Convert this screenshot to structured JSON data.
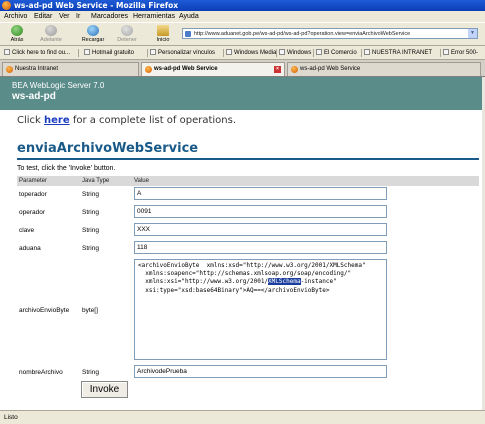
{
  "window": {
    "title": "ws-ad-pd Web Service - Mozilla Firefox"
  },
  "menu": [
    "Archivo",
    "Editar",
    "Ver",
    "Ir",
    "Marcadores",
    "Herramientas",
    "Ayuda"
  ],
  "nav": {
    "back": "Atrás",
    "forward": "Adelante",
    "reload": "Recargar",
    "stop": "Detener",
    "home": "Inicio",
    "url": "http://www.aduanet.gob.pe/ws-ad-pd/ws-ad-pd?operation.view=enviaArchivoWebService"
  },
  "bookmarks": [
    "Click here to find ou...",
    "Hotmail gratuito",
    "Personalizar vínculos",
    "Windows Media",
    "Windows",
    "El Comercio",
    "NUESTRA INTRANET",
    "Error 500-"
  ],
  "tabs": [
    {
      "label": "Nuestra Intranet",
      "active": false
    },
    {
      "label": "ws-ad-pd Web Service",
      "active": true
    },
    {
      "label": "ws-ad-pd Web Service",
      "active": false
    }
  ],
  "banner": {
    "line1": "BEA WebLogic Server 7.0",
    "line2": "ws-ad-pd"
  },
  "intro": {
    "before": "Click ",
    "link": "here",
    "after": " for a complete list of operations."
  },
  "operation": {
    "title": "enviaArchivoWebService",
    "test_msg": "To test, click the 'Invoke' button.",
    "headers": {
      "parameter": "Parameter",
      "java_type": "Java Type",
      "value": "Value"
    },
    "params": {
      "toperador": {
        "name": "toperador",
        "type": "String",
        "value": "A"
      },
      "operador": {
        "name": "operador",
        "type": "String",
        "value": "0091"
      },
      "clave": {
        "name": "clave",
        "type": "String",
        "value": "XXX"
      },
      "aduana": {
        "name": "aduana",
        "type": "String",
        "value": "118"
      },
      "archivoEnvioByte": {
        "name": "archivoEnvioByte",
        "type": "byte[]",
        "line1": "<archivoEnvioByte  xmlns:xsd=\"http://www.w3.org/2001/XMLSchema\"",
        "line2": "  xmlns:soapenc=\"http://schemas.xmlsoap.org/soap/encoding/\"",
        "line3_before": "  xmlns:xsi=\"http://www.w3.org/2001/",
        "line3_selected": "XMLSchema",
        "line3_after": "-instance\"",
        "line4": "  xsi:type=\"xsd:base64Binary\">AQ==</archivoEnvioByte>"
      },
      "nombreArchivo": {
        "name": "nombreArchivo",
        "type": "String",
        "value": "ArchivodePrueba"
      }
    },
    "invoke_label": "Invoke"
  },
  "status": {
    "text": "Listo"
  }
}
